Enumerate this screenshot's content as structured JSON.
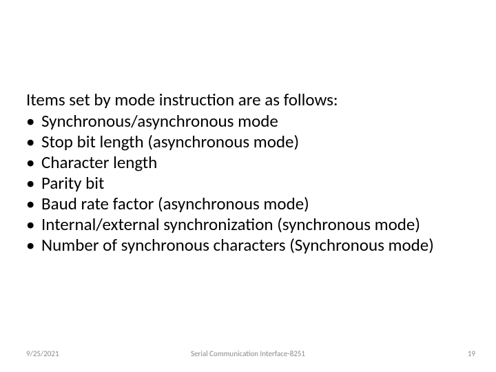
{
  "content": {
    "heading": "Items set by mode instruction are as follows:",
    "bullets": [
      "Synchronous/asynchronous mode",
      "Stop bit length (asynchronous mode)",
      "Character length",
      "Parity bit",
      "Baud rate factor (asynchronous mode)",
      "Internal/external synchronization (synchronous mode)",
      "Number of synchronous characters (Synchronous mode)"
    ]
  },
  "footer": {
    "date": "9/25/2021",
    "title": "Serial Communication Interface-8251",
    "page": "19"
  }
}
